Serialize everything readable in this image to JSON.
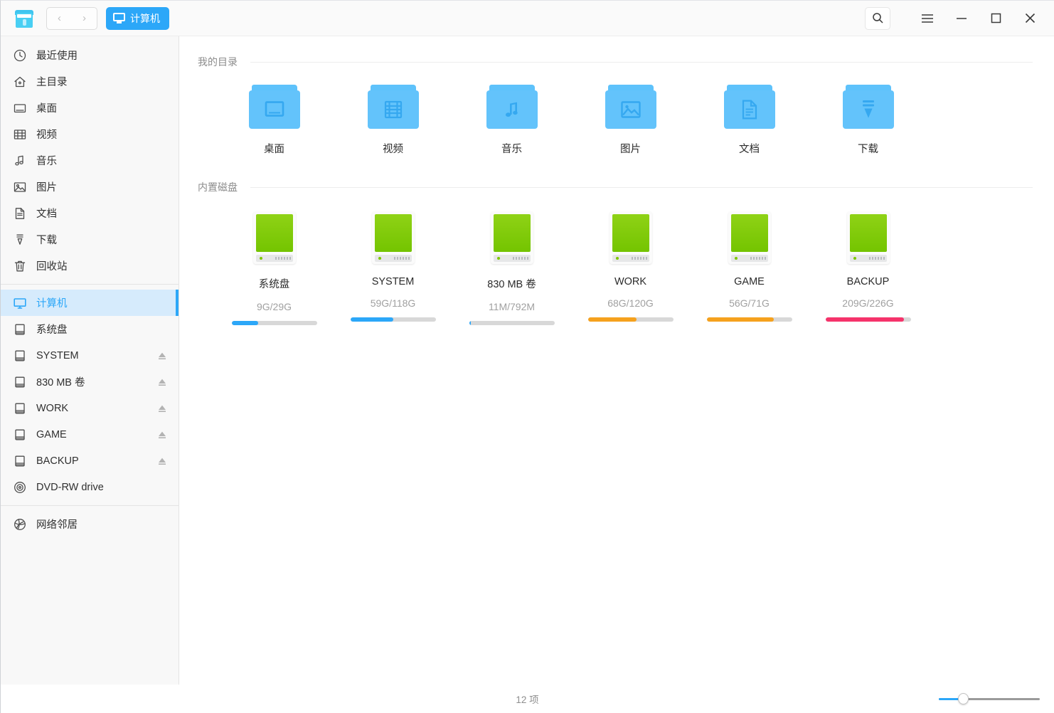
{
  "window": {
    "logo_icon": "file-manager-logo-icon",
    "nav": {
      "back_label": "‹",
      "forward_label": "›"
    },
    "tab": {
      "label": "计算机",
      "icon": "monitor-icon"
    },
    "controls": {
      "search_icon": "search-icon",
      "menu_icon": "hamburger-menu-icon",
      "minimize_icon": "minimize-icon",
      "maximize_icon": "maximize-icon",
      "close_icon": "close-icon"
    },
    "accent": "#2ca7f8"
  },
  "sidebar": {
    "items": [
      {
        "label": "最近使用",
        "icon": "clock-icon",
        "selected": false,
        "eject": false
      },
      {
        "label": "主目录",
        "icon": "home-icon",
        "selected": false,
        "eject": false
      },
      {
        "label": "桌面",
        "icon": "desktop-icon",
        "selected": false,
        "eject": false
      },
      {
        "label": "视频",
        "icon": "video-icon",
        "selected": false,
        "eject": false
      },
      {
        "label": "音乐",
        "icon": "music-icon",
        "selected": false,
        "eject": false
      },
      {
        "label": "图片",
        "icon": "picture-icon",
        "selected": false,
        "eject": false
      },
      {
        "label": "文档",
        "icon": "document-icon",
        "selected": false,
        "eject": false
      },
      {
        "label": "下载",
        "icon": "download-icon",
        "selected": false,
        "eject": false
      },
      {
        "label": "回收站",
        "icon": "trash-icon",
        "selected": false,
        "eject": false
      },
      {
        "separator": true
      },
      {
        "label": "计算机",
        "icon": "computer-icon",
        "selected": true,
        "eject": false
      },
      {
        "label": "系统盘",
        "icon": "disk-icon",
        "selected": false,
        "eject": false
      },
      {
        "label": "SYSTEM",
        "icon": "disk-icon",
        "selected": false,
        "eject": true
      },
      {
        "label": "830 MB 卷",
        "icon": "disk-icon",
        "selected": false,
        "eject": true
      },
      {
        "label": "WORK",
        "icon": "disk-icon",
        "selected": false,
        "eject": true
      },
      {
        "label": "GAME",
        "icon": "disk-icon",
        "selected": false,
        "eject": true
      },
      {
        "label": "BACKUP",
        "icon": "disk-icon",
        "selected": false,
        "eject": true
      },
      {
        "label": "DVD-RW drive",
        "icon": "optical-disc-icon",
        "selected": false,
        "eject": false
      },
      {
        "separator": true
      },
      {
        "label": "网络邻居",
        "icon": "network-icon",
        "selected": false,
        "eject": false
      }
    ]
  },
  "main": {
    "sections": [
      {
        "title": "我的目录",
        "kind": "folders",
        "items": [
          {
            "label": "桌面",
            "glyph": "desktop-glyph-icon"
          },
          {
            "label": "视频",
            "glyph": "film-glyph-icon"
          },
          {
            "label": "音乐",
            "glyph": "music-note-glyph-icon"
          },
          {
            "label": "图片",
            "glyph": "image-glyph-icon"
          },
          {
            "label": "文档",
            "glyph": "document-glyph-icon"
          },
          {
            "label": "下载",
            "glyph": "download-arrow-glyph-icon"
          }
        ]
      },
      {
        "title": "内置磁盘",
        "kind": "disks",
        "items": [
          {
            "label": "系统盘",
            "usage": "9G/29G",
            "percent": 31,
            "color": "#2ca7f8"
          },
          {
            "label": "SYSTEM",
            "usage": "59G/118G",
            "percent": 50,
            "color": "#2ca7f8"
          },
          {
            "label": "830 MB 卷",
            "usage": "11M/792M",
            "percent": 2,
            "color": "#2ca7f8"
          },
          {
            "label": "WORK",
            "usage": "68G/120G",
            "percent": 57,
            "color": "#f5a11d"
          },
          {
            "label": "GAME",
            "usage": "56G/71G",
            "percent": 79,
            "color": "#f5a11d"
          },
          {
            "label": "BACKUP",
            "usage": "209G/226G",
            "percent": 92,
            "color": "#f5336b"
          }
        ]
      }
    ]
  },
  "statusbar": {
    "item_count_text": "12 项",
    "zoom": {
      "value": 22
    }
  }
}
